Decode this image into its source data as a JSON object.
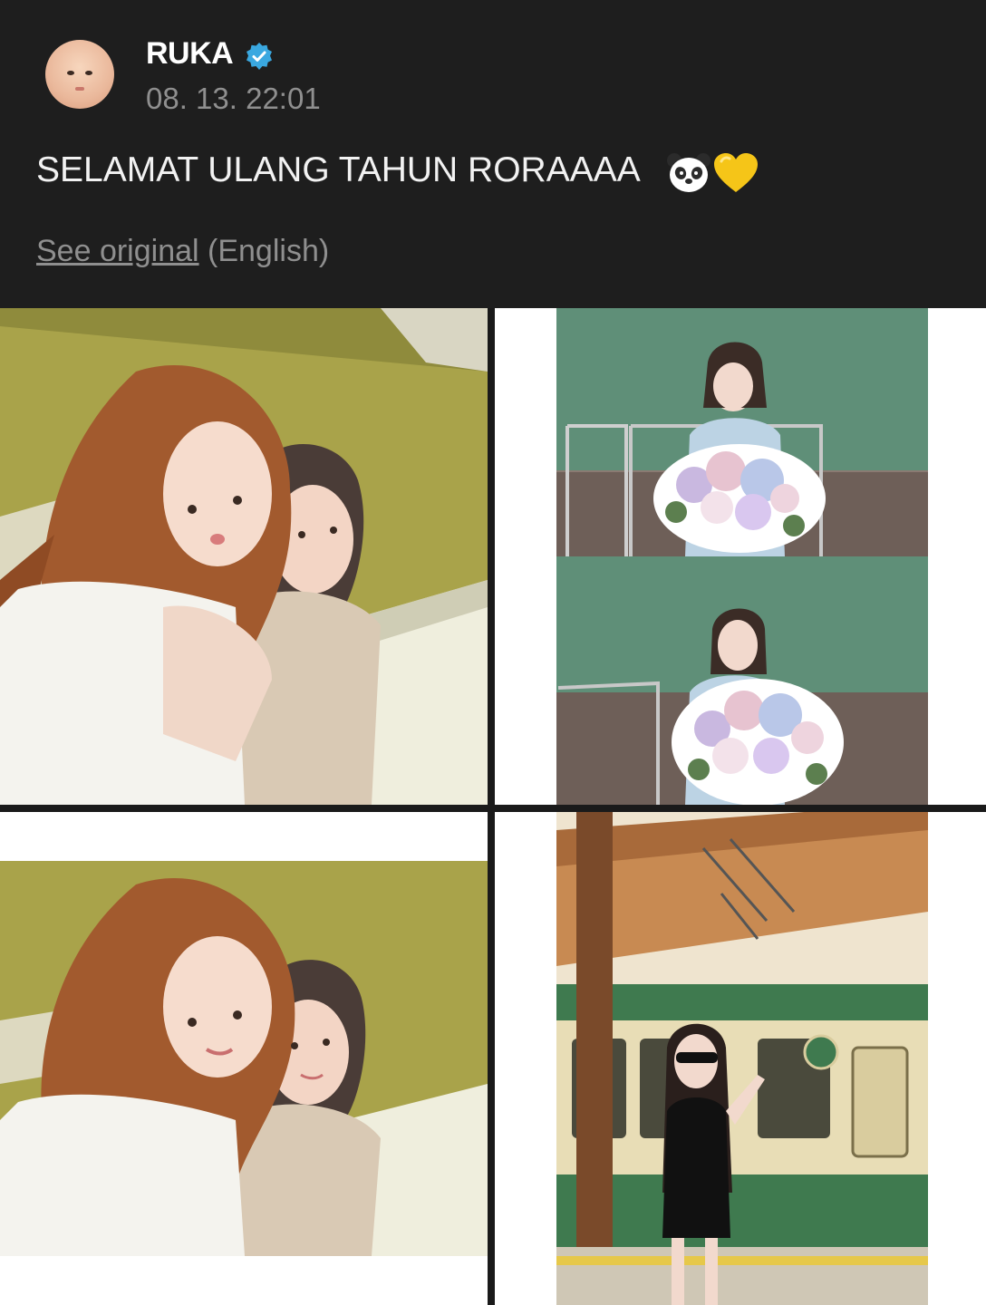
{
  "post": {
    "username": "RUKA",
    "verified": true,
    "timestamp": "08. 13. 22:01",
    "text": "SELAMAT ULANG TAHUN RORAAAA",
    "emojis": [
      "panda-emoji",
      "yellow-heart-emoji"
    ],
    "see_original_link": "See original",
    "see_original_lang": "(English)"
  },
  "photos": [
    {
      "name": "photo-selfie-duo-1",
      "subject": "two women selfie against olive green wall"
    },
    {
      "name": "photo-bouquet-top",
      "subject": "woman holding flower bouquet, green wall"
    },
    {
      "name": "photo-bouquet-bottom",
      "subject": "woman smelling flower bouquet, green wall"
    },
    {
      "name": "photo-selfie-duo-2",
      "subject": "two women selfie, second take"
    },
    {
      "name": "photo-train-station",
      "subject": "woman in sunglasses at train platform"
    }
  ],
  "colors": {
    "background": "#1e1e1e",
    "verified_badge": "#3aa8e0",
    "muted_text": "#8f8f8f",
    "heart": "#f5c518"
  }
}
